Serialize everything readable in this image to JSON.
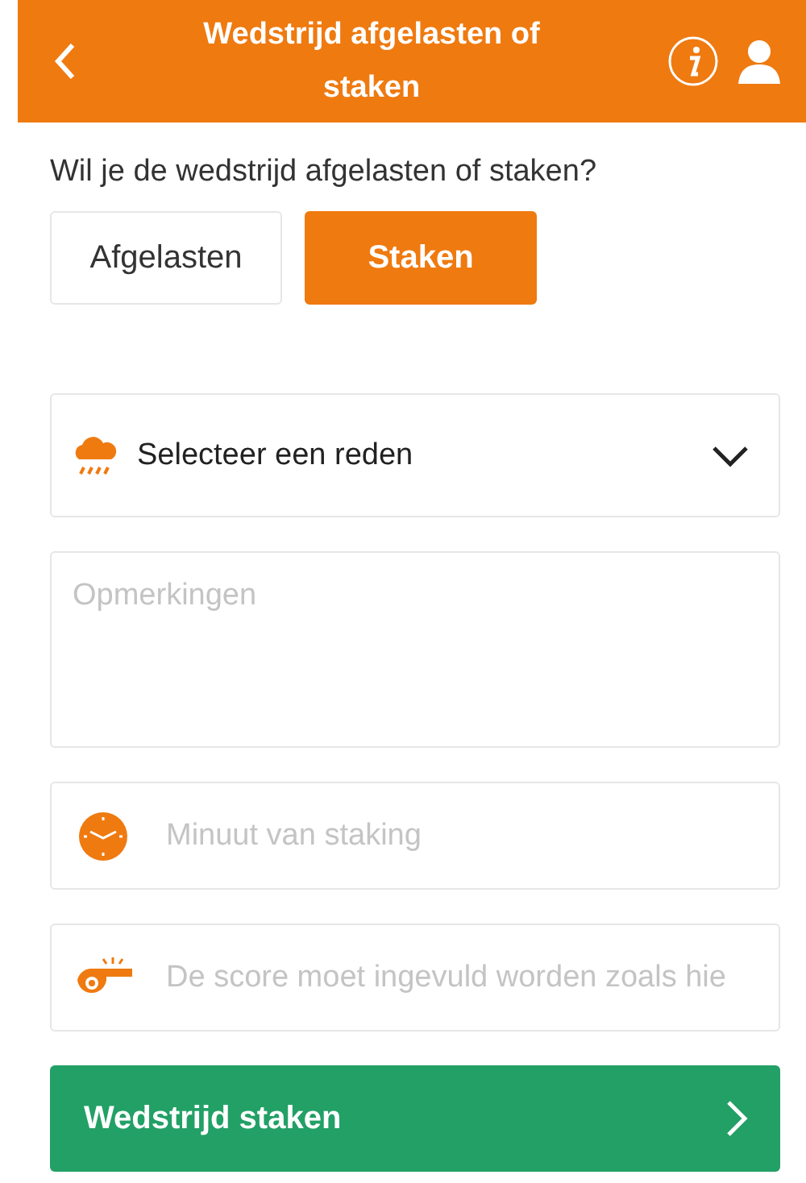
{
  "header": {
    "title": "Wedstrijd afgelasten of staken"
  },
  "question": "Wil je de wedstrijd afgelasten of staken?",
  "choices": [
    {
      "label": "Afgelasten",
      "selected": false
    },
    {
      "label": "Staken",
      "selected": true
    }
  ],
  "fields": [
    {
      "kind": "select",
      "label": "Selecteer een reden"
    },
    {
      "kind": "textarea",
      "placeholder": "Opmerkingen"
    },
    {
      "kind": "time",
      "placeholder": "Minuut van staking"
    },
    {
      "kind": "score",
      "placeholder": "De score moet ingevuld worden zoals hie"
    }
  ],
  "submit": {
    "label": "Wedstrijd staken"
  }
}
